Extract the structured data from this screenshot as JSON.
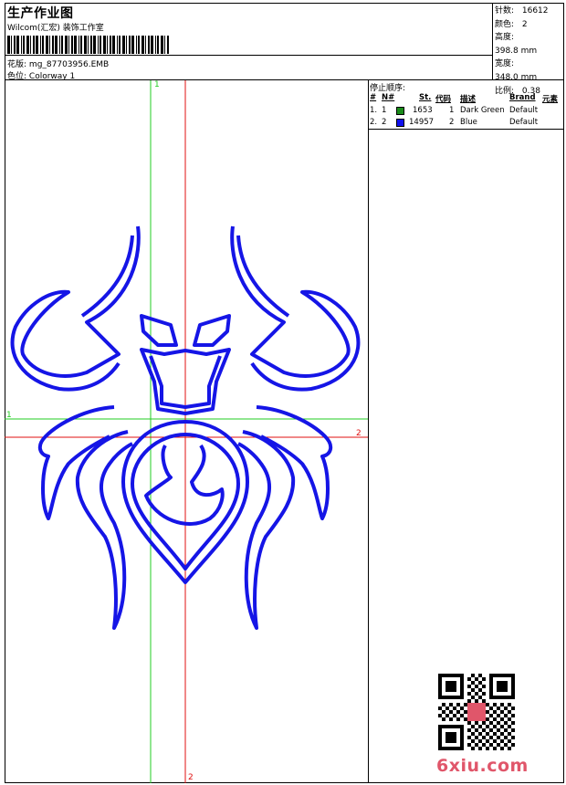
{
  "header": {
    "title": "生产作业图",
    "subtitle": "Wilcom(汇宏) 装饰工作室",
    "design_label": "花版:",
    "design_value": "mg_87703956.EMB",
    "colorway_label": "色位:",
    "colorway_value": "Colorway 1"
  },
  "stats": [
    {
      "label": "针数:",
      "value": "16612"
    },
    {
      "label": "颜色:",
      "value": "2"
    },
    {
      "label": "高度:",
      "value": "398.8 mm"
    },
    {
      "label": "宽度:",
      "value": "348.0 mm"
    },
    {
      "label": "比例:",
      "value": "0.38"
    }
  ],
  "stop_sequence": {
    "title": "停止顺序:",
    "headers": {
      "num": "#",
      "n": "N#",
      "st": "St.",
      "code": "代码",
      "desc": "描述",
      "brand": "Brand",
      "element": "元素"
    },
    "rows": [
      {
        "num": "1.",
        "n": "1",
        "color": "#1a8c1a",
        "st": "1653",
        "code": "1",
        "desc": "Dark Green",
        "brand": "Default"
      },
      {
        "num": "2.",
        "n": "2",
        "color": "#1010ee",
        "st": "14957",
        "code": "2",
        "desc": "Blue",
        "brand": "Default"
      }
    ]
  },
  "axes": {
    "green_v": "1",
    "green_h": "1",
    "red_h": "2",
    "red_v": "2"
  },
  "colors": {
    "design_blue": "#1515e6",
    "axis_green": "#22cc22",
    "axis_red": "#e01010"
  },
  "logo_text": "6xiu.com",
  "qr_icon": "qr-code-icon"
}
